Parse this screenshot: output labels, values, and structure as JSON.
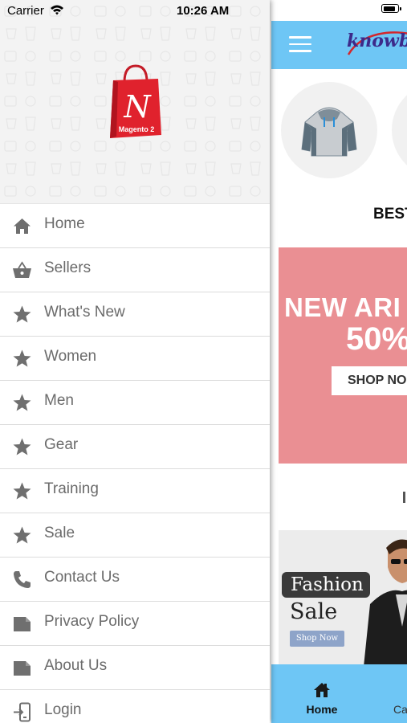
{
  "status_bar": {
    "carrier": "Carrier",
    "time": "10:26 AM"
  },
  "drawer": {
    "logo_caption": "Magento 2",
    "logo_letter": "N",
    "menu_items": [
      {
        "label": "Home",
        "icon": "home-icon"
      },
      {
        "label": "Sellers",
        "icon": "basket-icon"
      },
      {
        "label": "What's New",
        "icon": "star-icon"
      },
      {
        "label": "Women",
        "icon": "star-icon"
      },
      {
        "label": "Men",
        "icon": "star-icon"
      },
      {
        "label": "Gear",
        "icon": "star-icon"
      },
      {
        "label": "Training",
        "icon": "star-icon"
      },
      {
        "label": "Sale",
        "icon": "star-icon"
      },
      {
        "label": "Contact Us",
        "icon": "phone-icon"
      },
      {
        "label": "Privacy Policy",
        "icon": "page-icon"
      },
      {
        "label": "About Us",
        "icon": "page-icon"
      },
      {
        "label": "Login",
        "icon": "login-icon"
      }
    ]
  },
  "main": {
    "logo_text": "knowb",
    "section_title": "BEST",
    "promo_banner": {
      "line1": "NEW ARI",
      "line2": "50%",
      "button": "SHOP NO"
    },
    "fashion_banner": {
      "tag": "Fashion",
      "title": "Sale",
      "button": "Shop Now"
    },
    "bottom_tabs": {
      "home": "Home",
      "partial": "Ca"
    }
  },
  "colors": {
    "accent": "#6ec6f5",
    "promo_pink": "#ea8f93",
    "menu_text": "#6b6b6b",
    "menu_icon": "#6f6f6f"
  }
}
